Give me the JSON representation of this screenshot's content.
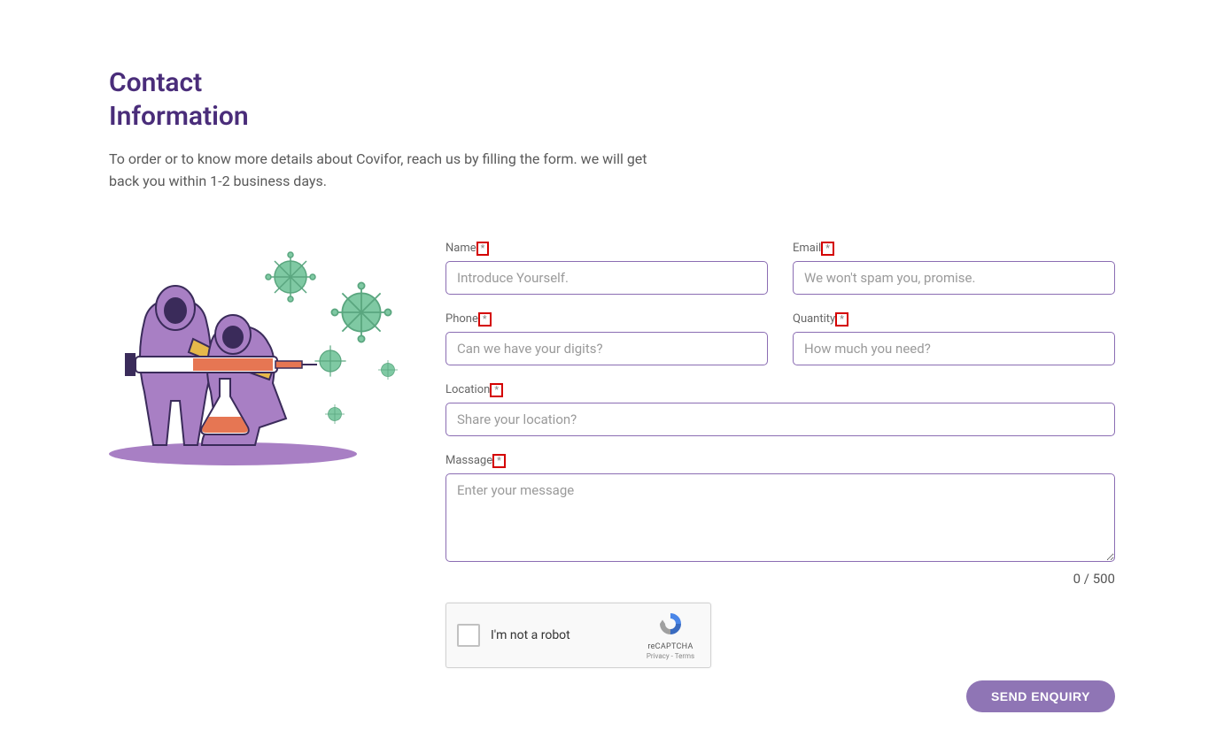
{
  "header": {
    "title_line1": "Contact",
    "title_line2": "Information",
    "description": "To order or to know more details about Covifor, reach us by filling the form. we will get back you within 1-2 business days."
  },
  "form": {
    "name": {
      "label": "Name",
      "placeholder": "Introduce Yourself.",
      "value": ""
    },
    "email": {
      "label": "Email",
      "placeholder": "We won't spam you, promise.",
      "value": ""
    },
    "phone": {
      "label": "Phone",
      "placeholder": "Can we have your digits?",
      "value": ""
    },
    "quantity": {
      "label": "Quantity",
      "placeholder": "How much you need?",
      "value": ""
    },
    "location": {
      "label": "Location",
      "placeholder": "Share your location?",
      "value": ""
    },
    "message": {
      "label": "Massage",
      "placeholder": "Enter your message",
      "value": ""
    },
    "required_mark": "*",
    "char_count": "0 / 500"
  },
  "recaptcha": {
    "text": "I'm not a robot",
    "brand": "reCAPTCHA",
    "privacy": "Privacy",
    "separator": " - ",
    "terms": "Terms"
  },
  "submit": {
    "label": "SEND ENQUIRY"
  },
  "colors": {
    "heading": "#4a2d7a",
    "input_border": "#8b6db3",
    "button_bg": "#8f75b5",
    "error_box": "#d40000"
  }
}
